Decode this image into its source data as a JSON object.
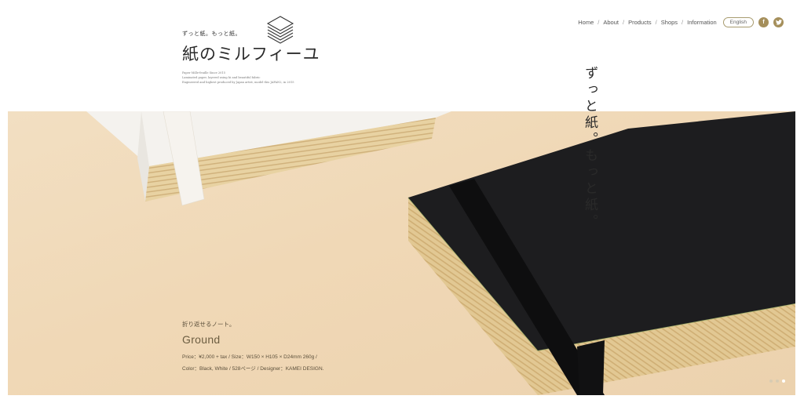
{
  "logo": {
    "tagline": "ずっと紙。もっと紙。",
    "title": "紙のミルフィーユ",
    "description": [
      "Paper Mille-feuille Since 2015",
      "Laminated paper, layered using hi and beautiful fabric",
      "Engineered and highest produced by Japan artist, model this JAPAN2, in 2015"
    ]
  },
  "nav": {
    "links": [
      "Home",
      "About",
      "Products",
      "Shops",
      "Information"
    ],
    "separator": "/",
    "lang_label": "English",
    "facebook_label": "f",
    "twitter_label": "t"
  },
  "hero": {
    "vertical_copy": "ずっと紙。もっと紙。",
    "product": {
      "subtitle": "折り返せるノート。",
      "name": "Ground",
      "spec_line1": "Price：¥2,000 + tax / Size：W150 × H105 × D24mm 260g /",
      "spec_line2": "Color：Black, White / 528ページ / Designer：KAMEI DESIGN."
    },
    "slides_total": 3,
    "active_slide": 3
  },
  "colors": {
    "accent": "#a58f5b",
    "hero_bg": "#f0d8b6",
    "notebook_black": "#1d1d1f"
  }
}
